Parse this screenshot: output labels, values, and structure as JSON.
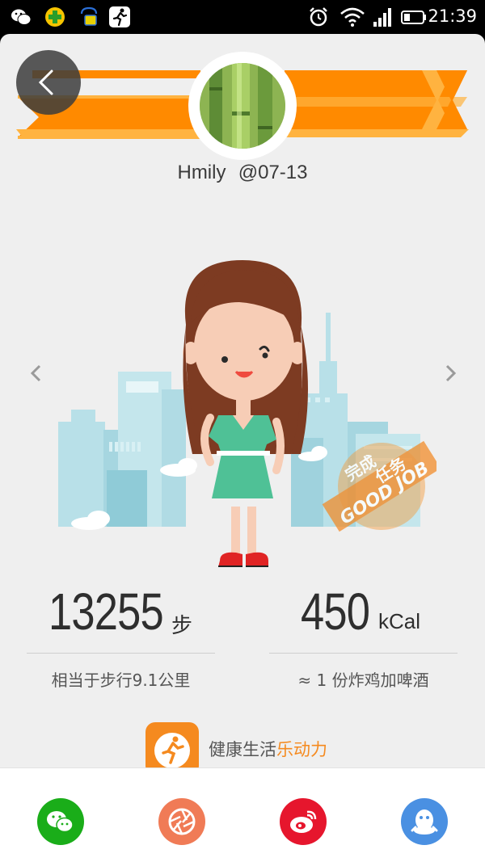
{
  "status_bar": {
    "time": "21:39",
    "left_icons": [
      "wechat-icon",
      "game-center-icon",
      "notification-bag-icon",
      "running-app-icon"
    ],
    "right_icons": [
      "alarm-icon",
      "wifi-icon",
      "signal-icon",
      "battery-icon"
    ]
  },
  "profile": {
    "name": "Hmily",
    "date": "@07-13"
  },
  "stamp": {
    "line1": "完成",
    "line2": "任务",
    "text": "GOOD JOB"
  },
  "steps": {
    "value": "13255",
    "unit": "步",
    "description": "相当于步行9.1公里"
  },
  "calories": {
    "value": "450",
    "unit": "kCal",
    "description": "≈ 1 份炸鸡加啤酒"
  },
  "promo": {
    "text_plain": "健康生活",
    "text_highlight": "乐动力"
  },
  "share": [
    {
      "name": "wechat",
      "color": "#1aad19"
    },
    {
      "name": "moments",
      "color": "#f07b56"
    },
    {
      "name": "weibo",
      "color": "#e6162d"
    },
    {
      "name": "qq",
      "color": "#4a90e2"
    }
  ],
  "colors": {
    "accent_orange": "#f58a1f",
    "ribbon_orange": "#ff8a00",
    "ribbon_light": "#ffb340",
    "background": "#efefef"
  }
}
